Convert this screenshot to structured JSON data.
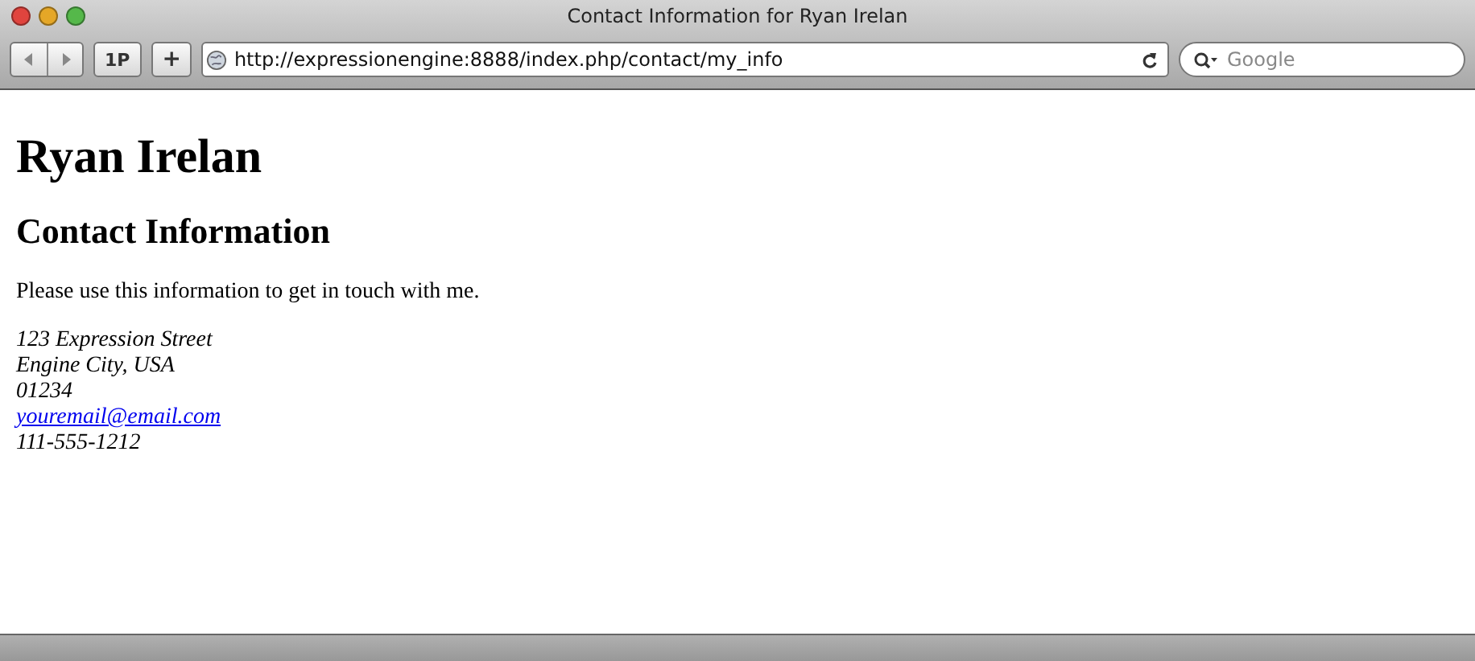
{
  "window": {
    "title": "Contact Information for Ryan Irelan"
  },
  "toolbar": {
    "bookmarklet": "1P",
    "add": "+",
    "address": "http://expressionengine:8888/index.php/contact/my_info",
    "search": {
      "placeholder": "Google"
    }
  },
  "page": {
    "heading": "Ryan Irelan",
    "subheading": "Contact Information",
    "intro": "Please use this information to get in touch with me.",
    "address_lines": [
      {
        "kind": "text",
        "text": "123 Expression Street"
      },
      {
        "kind": "text",
        "text": "Engine City, USA"
      },
      {
        "kind": "text",
        "text": "01234"
      },
      {
        "kind": "link",
        "text": "youremail@email.com"
      },
      {
        "kind": "text",
        "text": "111-555-1212"
      }
    ]
  }
}
